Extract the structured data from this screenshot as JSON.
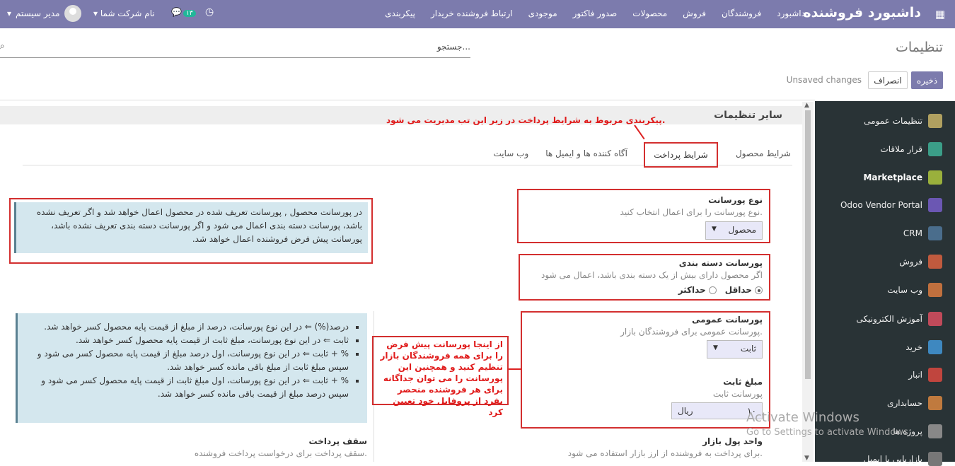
{
  "topbar": {
    "brand": "داشبورد فروشنده",
    "menu": [
      "داشبورد",
      "فروشندگان",
      "فروش",
      "محصولات",
      "صدور فاکتور",
      "موجودی",
      "ارتباط فروشنده خریدار",
      "پیکربندی"
    ],
    "company": "نام شرکت شما",
    "chat_count": "۱۳",
    "user": "مدیر سیستم"
  },
  "page": {
    "title": "تنظیمات",
    "search_placeholder": "جستجو...",
    "save": "ذخیره",
    "discard": "انصراف",
    "unsaved": "Unsaved changes"
  },
  "sidebar": {
    "items": [
      {
        "label": "تنظیمات عمومی",
        "color": "#b0a060"
      },
      {
        "label": "قرار ملاقات",
        "color": "#3b9e88"
      },
      {
        "label": "Marketplace",
        "color": "#9ab03c"
      },
      {
        "label": "Odoo Vendor Portal",
        "color": "#6b57b3"
      },
      {
        "label": "CRM",
        "color": "#4a6d8c"
      },
      {
        "label": "فروش",
        "color": "#c05a3e"
      },
      {
        "label": "وب سایت",
        "color": "#c0703e"
      },
      {
        "label": "آموزش الکترونیکی",
        "color": "#c04a5a"
      },
      {
        "label": "خرید",
        "color": "#3e88c0"
      },
      {
        "label": "انبار",
        "color": "#c0453e"
      },
      {
        "label": "حسابداری",
        "color": "#c07a3e"
      },
      {
        "label": "پروژه ها",
        "color": "#888888"
      },
      {
        "label": "بازاریابی با ایمیل",
        "color": "#777777"
      }
    ]
  },
  "section": {
    "title": "سایر تنظیمات",
    "annotation_top": "پیکربندی مربوط به شرایط پرداخت در زیر این تب مدیریت می شود.",
    "tabs": [
      "شرایط محصول",
      "شرایط پرداخت",
      "آگاه کننده ها و ایمیل ها",
      "وب سایت"
    ]
  },
  "fields": {
    "commission_type": {
      "label": "نوع پورسانت",
      "hint": "نوع پورسانت را برای اعمال انتخاب کنید.",
      "value": "محصول"
    },
    "category_commission": {
      "label": "پورسانت دسته بندی",
      "hint": "اگر محصول دارای بیش از یک دسته بندی باشد، اعمال می شود",
      "opt_min": "حداقل",
      "opt_max": "حداکثر"
    },
    "general_commission": {
      "label": "پورسانت عمومی",
      "hint": "پورسانت عمومی برای فروشندگان بازار.",
      "value": "ثابت"
    },
    "fixed_amount": {
      "label": "مبلغ ثابت",
      "hint": "پورسانت ثابت",
      "value": "۱۰",
      "unit": "ریال"
    },
    "currency": {
      "label": "واحد پول بازار",
      "hint": "برای پرداخت به فروشنده از ارز بازار استفاده می شود."
    },
    "payment_cap": {
      "label": "سقف پرداخت",
      "hint": "سقف پرداخت برای درخواست پرداخت فروشنده."
    }
  },
  "info": {
    "product_commission_bold": "پورسانت محصول",
    "product_commission_text": "در پورسانت محصول , پورسانت تعریف شده در محصول اعمال خواهد شد و اگر تعریف نشده باشد، پورسانت دسته بندی اعمال می شود و اگر پورسانت دسته بندی تعریف نشده باشد، پورسانت پیش فرض فروشنده اعمال خواهد شد.",
    "bullets": [
      "درصد(%) ⇐ در این نوع پورسانت، درصد از مبلغ از قیمت پایه محصول کسر خواهد شد.",
      "ثابت ⇐ در این نوع پورسانت، مبلغ ثابت از قیمت پایه محصول کسر خواهد شد.",
      "% + ثابت ⇐ در این نوع پورسانت، اول درصد مبلغ از قیمت پایه محصول کسر می شود و سپس مبلغ ثابت از مبلغ باقی مانده کسر خواهد شد.",
      "% + ثابت ⇐ در این نوع پورسانت، اول مبلغ ثابت از قیمت پایه محصول کسر می شود و سپس درصد مبلغ از قیمت باقی مانده کسر خواهد شد."
    ],
    "note": "از اینجا پورسانت پیش فرض را برای همه فروشندگان بازار تنظیم کنید و همچنین این پورسانت را می توان جداگانه برای هر فروشنده منحصر بفرد از پروفایل خود تعیین کرد"
  },
  "watermark": {
    "line1": "Activate Windows",
    "line2": "Go to Settings to activate Windows."
  }
}
